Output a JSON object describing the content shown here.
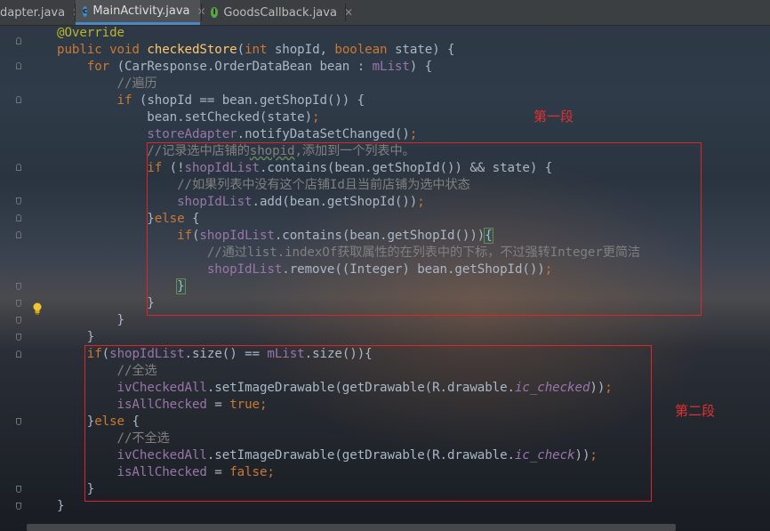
{
  "tabs": [
    {
      "name": "Adapter.java",
      "label": "dapter.java",
      "icon": "none",
      "active": false
    },
    {
      "name": "MainActivity.java",
      "label": "MainActivity.java",
      "icon": "class-icon",
      "active": true
    },
    {
      "name": "GoodsCallback.java",
      "label": "GoodsCallback.java",
      "icon": "interface-icon",
      "active": false
    }
  ],
  "code_lines": [
    "@Override",
    "public void checkedStore(int shopId, boolean state) {",
    "    for (CarResponse.OrderDataBean bean : mList) {",
    "        //遍历",
    "        if (shopId == bean.getShopId()) {",
    "            bean.setChecked(state);",
    "            storeAdapter.notifyDataSetChanged();",
    "            //记录选中店铺的shopid,添加到一个列表中。",
    "            if (!shopIdList.contains(bean.getShopId()) && state) {",
    "                //如果列表中没有这个店铺Id且当前店铺为选中状态",
    "                shopIdList.add(bean.getShopId());",
    "            }else {",
    "                if(shopIdList.contains(bean.getShopId())){",
    "                    //通过list.indexOf获取属性的在列表中的下标，不过强转Integer更简洁",
    "                    shopIdList.remove((Integer) bean.getShopId());",
    "                }",
    "            }",
    "        }",
    "    }",
    "    if(shopIdList.size() == mList.size()){",
    "        //全选",
    "        ivCheckedAll.setImageDrawable(getDrawable(R.drawable.ic_checked));",
    "        isAllChecked = true;",
    "    }else {",
    "        //不全选",
    "        ivCheckedAll.setImageDrawable(getDrawable(R.drawable.ic_check));",
    "        isAllChecked = false;",
    "    }",
    "}"
  ],
  "annotations": {
    "section1": "第一段",
    "section2": "第二段"
  },
  "colors": {
    "keyword": "#cc7832",
    "annotation": "#bbb529",
    "method": "#ffc66d",
    "field": "#9876aa",
    "comment": "#808080",
    "text": "#a9b7c6",
    "highlight_box": "#e0242a"
  },
  "icons": {
    "class_icon": "c-circle-icon",
    "interface_icon": "i-circle-icon",
    "bulb": "lightbulb-icon"
  }
}
